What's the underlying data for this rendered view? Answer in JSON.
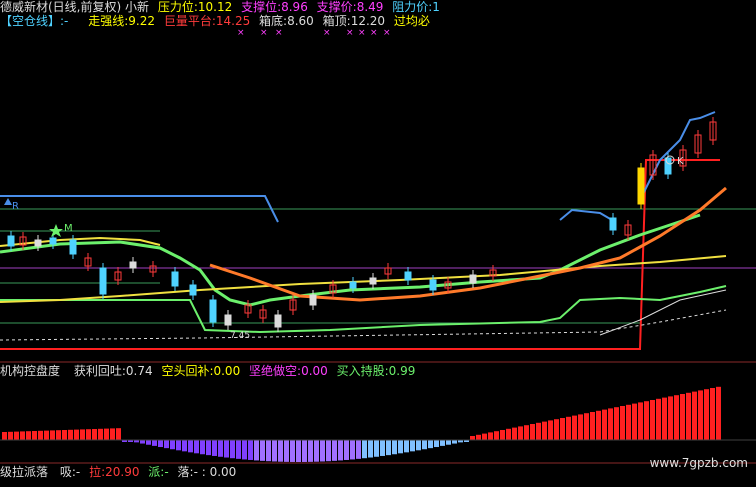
{
  "header": {
    "title": "德威新材(日线,前复权) 小新",
    "pressure_label": "压力位:",
    "pressure_value": "10.12",
    "support1_label": "支撑位:",
    "support1_value": "8.96",
    "support2_label": "支撑价:",
    "support2_value": "8.49",
    "resistance_label": "阻力价:",
    "resistance_value": "1"
  },
  "header2": {
    "empty_line_label": "【空仓线】:",
    "empty_line_value": "-",
    "strong_label": "走强线:",
    "strong_value": "9.22",
    "platform_label": "巨量平台:",
    "platform_value": "14.25",
    "box_bottom_label": "箱底:",
    "box_bottom_value": "8.60",
    "box_top_label": "箱顶:",
    "box_top_value": "12.20",
    "pass_label": "过均必"
  },
  "marks": {
    "x_mark": "×",
    "low_price": "7.45",
    "r_mark": "R",
    "m_mark": "M",
    "k_mark": "K"
  },
  "indicator": {
    "title": "机构控盘度",
    "profit_label": "获利回吐:",
    "profit_value": "0.74",
    "short_label": "空头回补:",
    "short_value": "0.00",
    "empty_label": "坚绝做空:",
    "empty_value": "0.00",
    "buy_label": "买入持股:",
    "buy_value": "0.99"
  },
  "footer": {
    "title": "级拉派落",
    "xi_label": "吸:",
    "xi_value": "-",
    "la_label": "拉:",
    "la_value": "20.90",
    "pai_label": "派:",
    "pai_value": "-",
    "luo_label": "落:",
    "luo_value": "- : 0.00"
  },
  "watermark": "www.7gpzb.com",
  "colors": {
    "yellow": "#e8d23a",
    "red": "#ff3b3b",
    "magenta": "#ff40ff",
    "green": "#6cf06c",
    "cyan": "#4fd2ff",
    "white": "#dcdcdc",
    "blue": "#5aa0ff"
  }
}
